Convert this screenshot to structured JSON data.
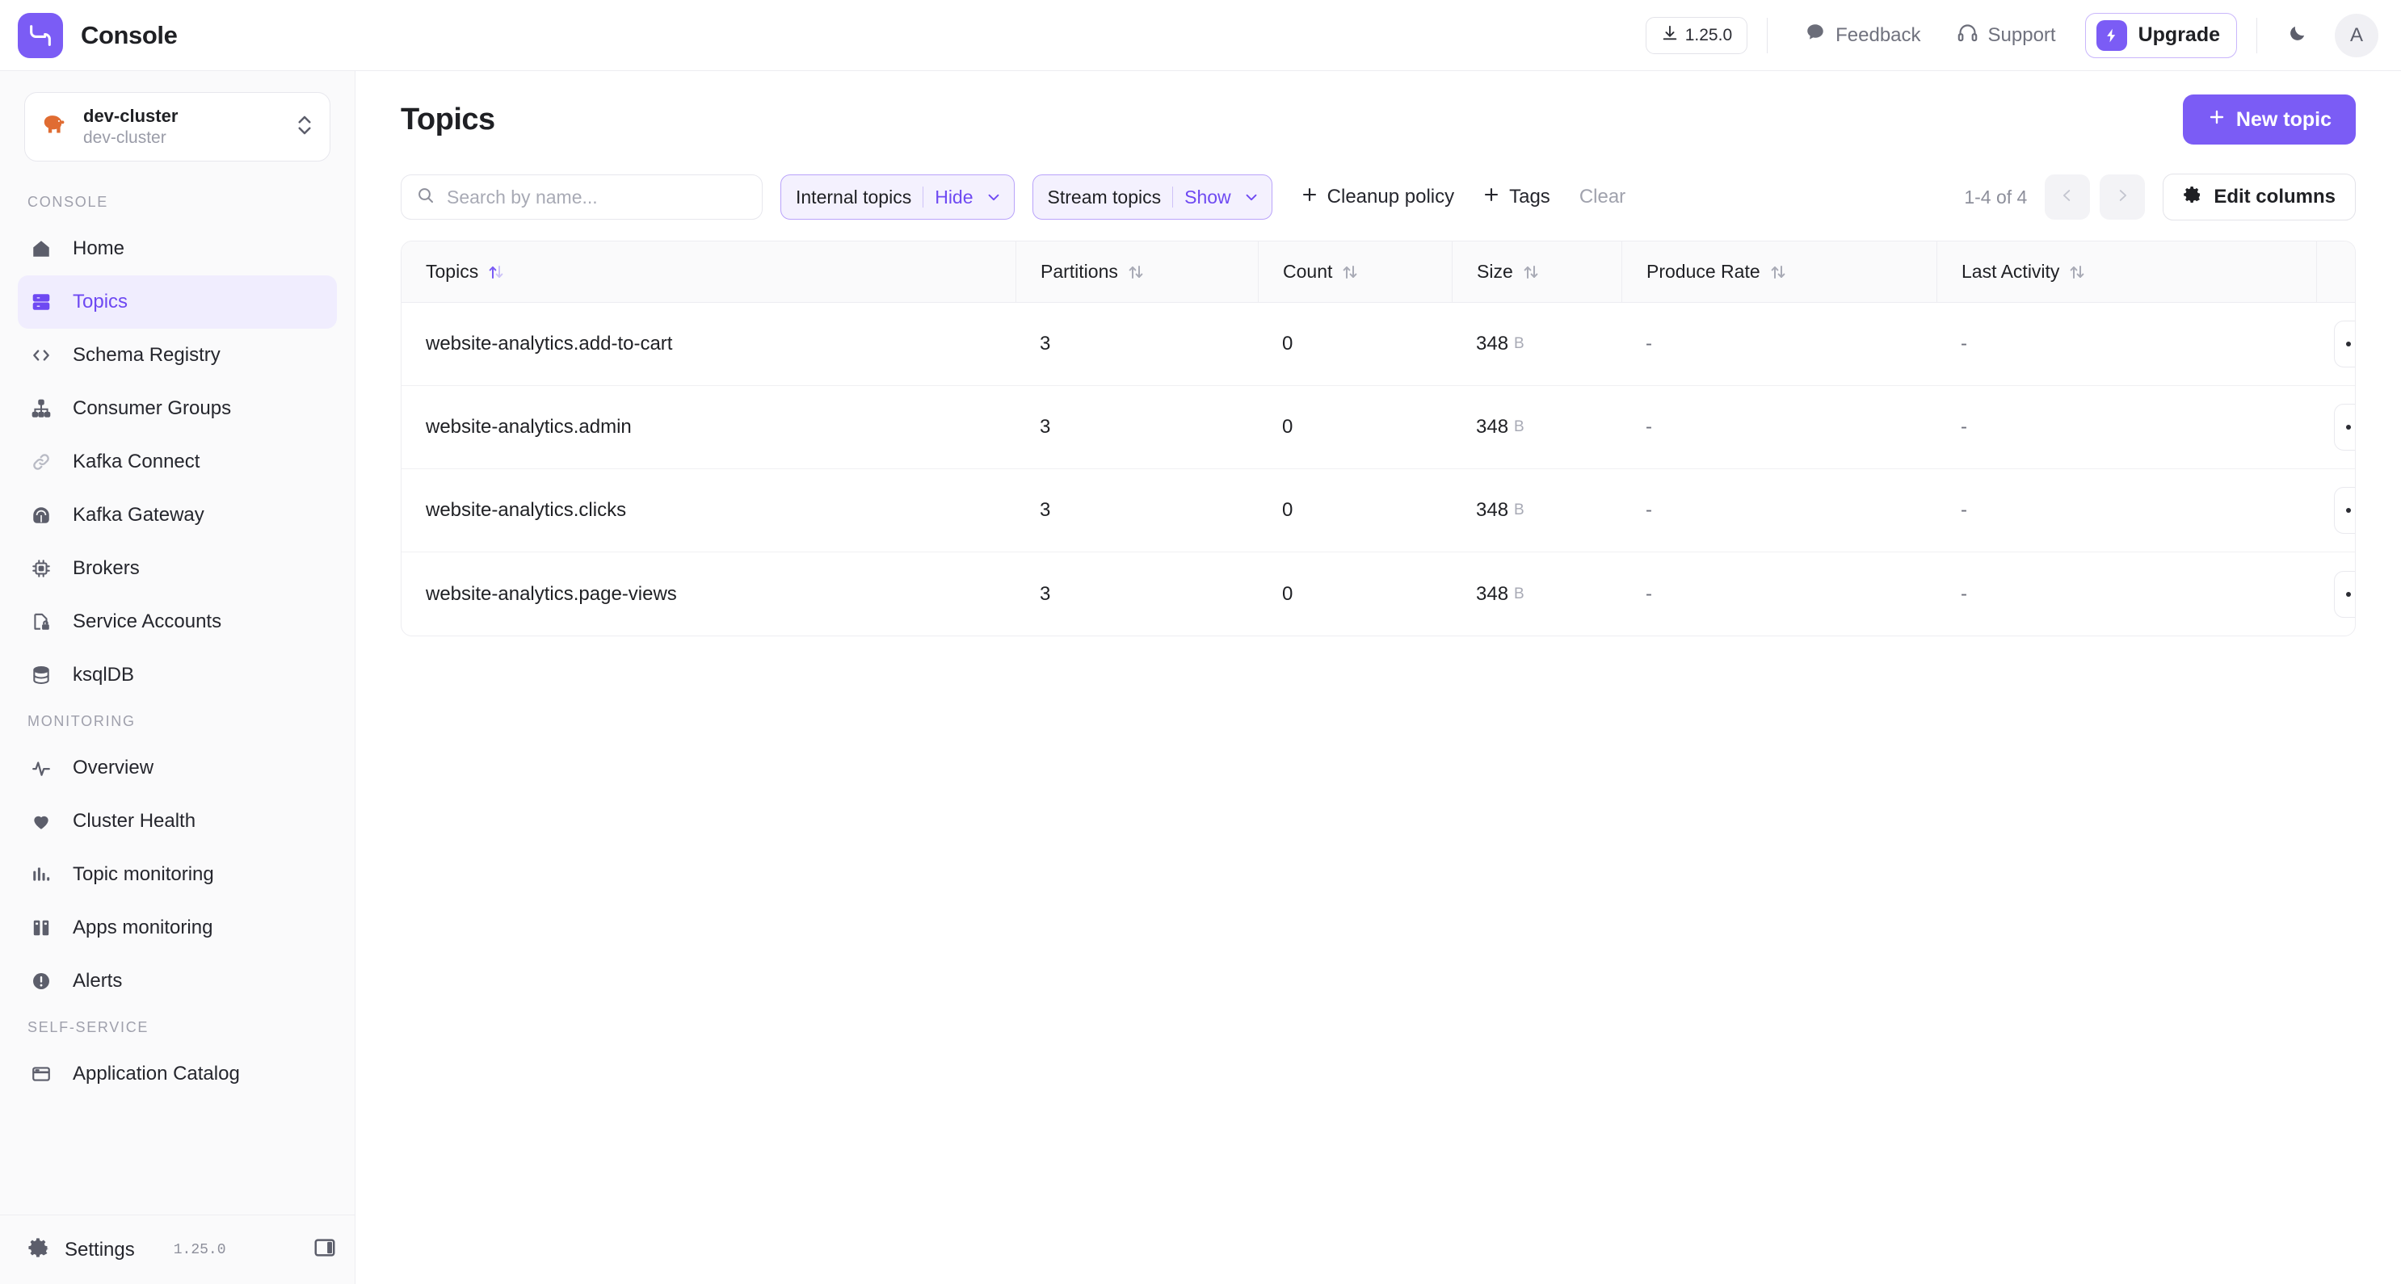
{
  "topbar": {
    "brand": "Console",
    "logo_icon": "conduktor-logo-icon",
    "version_badge": "1.25.0",
    "version_icon": "download-icon",
    "feedback": "Feedback",
    "feedback_icon": "chat-bubble-icon",
    "support": "Support",
    "support_icon": "headset-icon",
    "upgrade": "Upgrade",
    "upgrade_icon": "lightning-bolt-icon",
    "theme_icon": "moon-icon",
    "avatar_initial": "A",
    "accent": "#7b5cf5"
  },
  "sidebar": {
    "cluster": {
      "name": "dev-cluster",
      "subtitle": "dev-cluster",
      "icon": "elephant-icon",
      "chevron_icon": "chevron-up-down-icon"
    },
    "groups": [
      {
        "label": "CONSOLE",
        "items": [
          {
            "label": "Home",
            "icon": "home-icon",
            "active": false
          },
          {
            "label": "Topics",
            "icon": "topics-icon",
            "active": true
          },
          {
            "label": "Schema Registry",
            "icon": "code-brackets-icon",
            "active": false
          },
          {
            "label": "Consumer Groups",
            "icon": "hierarchy-icon",
            "active": false
          },
          {
            "label": "Kafka Connect",
            "icon": "link-chain-icon",
            "active": false
          },
          {
            "label": "Kafka Gateway",
            "icon": "gateway-icon",
            "active": false
          },
          {
            "label": "Brokers",
            "icon": "chip-icon",
            "active": false
          },
          {
            "label": "Service Accounts",
            "icon": "lock-file-icon",
            "active": false
          },
          {
            "label": "ksqlDB",
            "icon": "database-icon",
            "active": false
          }
        ]
      },
      {
        "label": "MONITORING",
        "items": [
          {
            "label": "Overview",
            "icon": "pulse-icon",
            "active": false
          },
          {
            "label": "Cluster Health",
            "icon": "heart-icon",
            "active": false
          },
          {
            "label": "Topic monitoring",
            "icon": "bar-chart-icon",
            "active": false
          },
          {
            "label": "Apps monitoring",
            "icon": "apps-icon",
            "active": false
          },
          {
            "label": "Alerts",
            "icon": "alert-circle-icon",
            "active": false
          }
        ]
      },
      {
        "label": "SELF-SERVICE",
        "items": [
          {
            "label": "Application Catalog",
            "icon": "window-icon",
            "active": false
          }
        ]
      }
    ],
    "footer": {
      "settings_label": "Settings",
      "settings_icon": "gear-icon",
      "version": "1.25.0",
      "collapse_icon": "panel-toggle-icon"
    }
  },
  "main": {
    "page_title": "Topics",
    "new_topic_label": "New topic",
    "new_topic_icon": "plus-icon",
    "search": {
      "placeholder": "Search by name...",
      "value": "",
      "icon": "search-icon"
    },
    "filters": [
      {
        "key": "Internal topics",
        "value": "Hide",
        "caret_icon": "chevron-down-icon"
      },
      {
        "key": "Stream topics",
        "value": "Show",
        "caret_icon": "chevron-down-icon"
      }
    ],
    "add_filters": [
      {
        "label": "Cleanup policy",
        "icon": "plus-icon"
      },
      {
        "label": "Tags",
        "icon": "plus-icon"
      }
    ],
    "clear_label": "Clear",
    "pagination": {
      "range": "1-4 of 4",
      "prev_icon": "chevron-left-icon",
      "next_icon": "chevron-right-icon"
    },
    "edit_columns": {
      "label": "Edit columns",
      "icon": "gear-icon"
    },
    "table": {
      "columns": [
        {
          "label": "Topics",
          "sort_active": true
        },
        {
          "label": "Partitions",
          "sort_active": false
        },
        {
          "label": "Count",
          "sort_active": false
        },
        {
          "label": "Size",
          "sort_active": false
        },
        {
          "label": "Produce Rate",
          "sort_active": false
        },
        {
          "label": "Last Activity",
          "sort_active": false
        }
      ],
      "rows": [
        {
          "topic": "website-analytics.add-to-cart",
          "partitions": "3",
          "count": "0",
          "size_value": "348",
          "size_unit": "B",
          "produce_rate": "-",
          "last_activity": "-",
          "menu_icon": "kebab-menu-icon"
        },
        {
          "topic": "website-analytics.admin",
          "partitions": "3",
          "count": "0",
          "size_value": "348",
          "size_unit": "B",
          "produce_rate": "-",
          "last_activity": "-",
          "menu_icon": "kebab-menu-icon"
        },
        {
          "topic": "website-analytics.clicks",
          "partitions": "3",
          "count": "0",
          "size_value": "348",
          "size_unit": "B",
          "produce_rate": "-",
          "last_activity": "-",
          "menu_icon": "kebab-menu-icon"
        },
        {
          "topic": "website-analytics.page-views",
          "partitions": "3",
          "count": "0",
          "size_value": "348",
          "size_unit": "B",
          "produce_rate": "-",
          "last_activity": "-",
          "menu_icon": "kebab-menu-icon"
        }
      ]
    }
  }
}
